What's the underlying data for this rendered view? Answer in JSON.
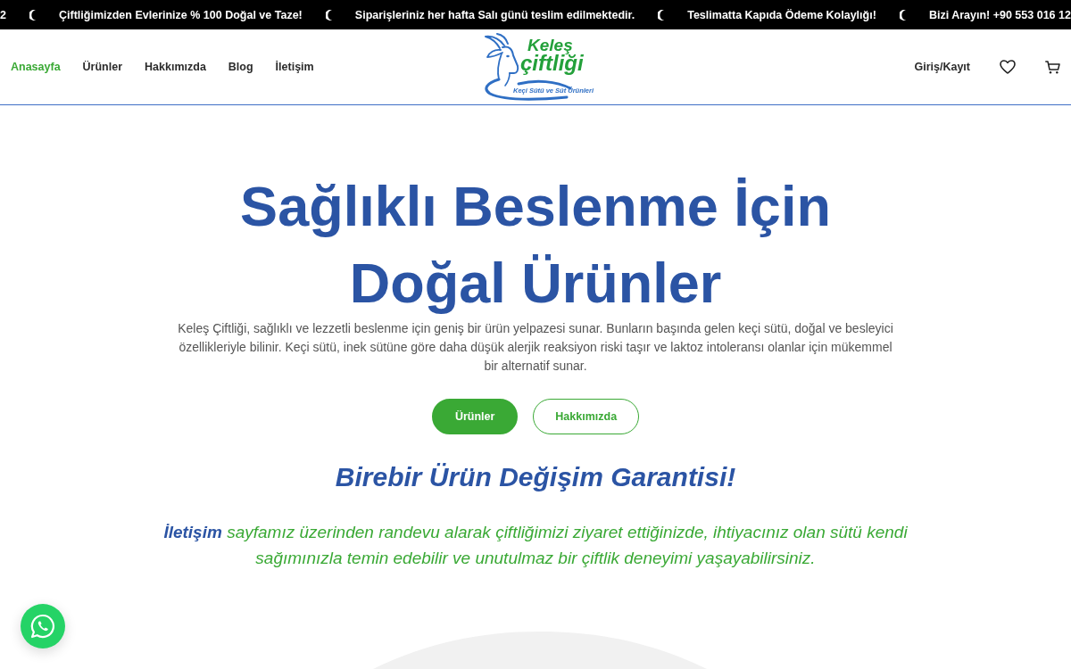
{
  "announcement_bar": {
    "items": [
      "2",
      "Çiftliğimizden Evlerinize % 100 Doğal ve Taze!",
      "Siparişleriniz her hafta Salı günü teslim edilmektedir.",
      "Teslimatta Kapıda Ödeme Kolaylığı!",
      "Bizi Arayın! +90 553 016 12"
    ]
  },
  "header": {
    "nav": [
      {
        "label": "Anasayfa",
        "selected": true
      },
      {
        "label": "Ürünler",
        "selected": false
      },
      {
        "label": "Hakkımızda",
        "selected": false
      },
      {
        "label": "Blog",
        "selected": false
      },
      {
        "label": "İletişim",
        "selected": false
      }
    ],
    "logo": {
      "name_top": "Keleş",
      "name_bottom": "çiftliği",
      "tagline": "Keçi Sütü ve Süt Ürünleri"
    },
    "account_link": "Giriş/Kayıt"
  },
  "hero": {
    "title": "Sağlıklı Beslenme İçin Doğal Ürünler",
    "description": "Keleş Çiftliği, sağlıklı ve lezzetli beslenme için geniş bir ürün yelpazesi sunar. Bunların başında gelen keçi sütü, doğal ve besleyici özellikleriyle bilinir. Keçi sütü, inek sütüne göre daha düşük alerjik reaksiyon riski taşır ve laktoz intoleransı olanlar için mükemmel bir alternatif sunar.",
    "buttons": [
      {
        "label": "Ürünler",
        "kind": "primary"
      },
      {
        "label": "Hakkımızda",
        "kind": "outline"
      }
    ],
    "guarantee_title": "Birebir Ürün Değişim Garantisi!",
    "contact_note": {
      "link": "İletişim",
      "text": "sayfamız üzerinden randevu alarak çiftliğimizi ziyaret ettiğinizde, ihtiyacınız olan sütü kendi sağımınızla temin edebilir ve unutulmaz bir çiftlik deneyimi yaşayabilirsiniz."
    }
  }
}
